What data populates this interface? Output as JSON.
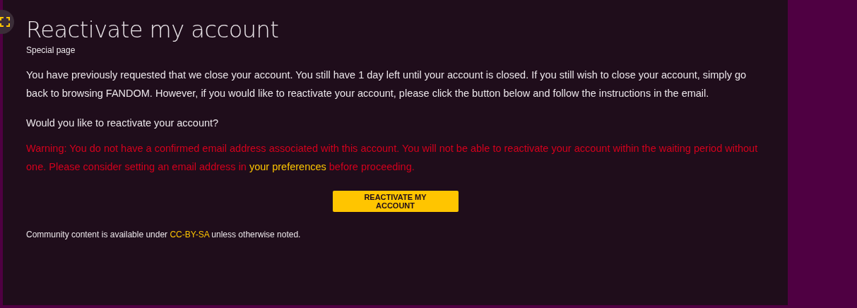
{
  "page": {
    "title": "Reactivate my account",
    "subtitle": "Special page"
  },
  "intro": "You have previously requested that we close your account. You still have 1 day left until your account is closed. If you still wish to close your account, simply go back to browsing FANDOM. However, if you would like to reactivate your account, please click the button below and follow the instructions in the email.",
  "question": "Would you like to reactivate your account?",
  "warning": {
    "before": "Warning: You do not have a confirmed email address associated with this account. You will not be able to reactivate your account within the waiting period without one. Please consider setting an email address in",
    "link": "your preferences",
    "after": "before proceeding."
  },
  "button": "REACTIVATE MY ACCOUNT",
  "footer": {
    "before": "Community content is available under",
    "link": "CC-BY-SA",
    "after": "unless otherwise noted."
  }
}
